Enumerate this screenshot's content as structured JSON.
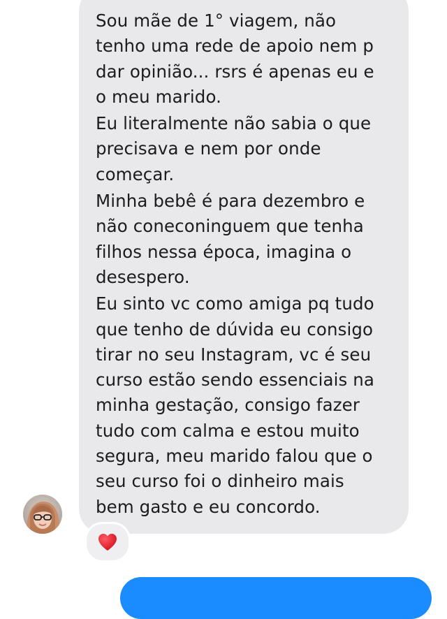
{
  "conversation": {
    "incoming_message": {
      "paragraphs": [
        "Sou mãe de 1° viagem, não\ntenho uma rede de apoio nem p\ndar opinião... rsrs é apenas eu e\no meu marido.",
        "Eu literalmente não sabia o que\nprecisava e nem por onde\ncomeçar.",
        "Minha bebê é para dezembro e\nnão coneconinguem que tenha\nfilhos nessa época, imagina o\ndesespero.",
        "Eu sinto vc como amiga pq tudo\nque tenho de dúvida eu consigo\ntirar no seu Instagram,  vc é seu\ncurso estão sendo essenciais na\nminha gestação, consigo fazer\ntudo com calma e estou muito\nsegura, meu marido falou que o\nseu curso foi o dinheiro mais\nbem gasto e eu concordo."
      ],
      "reaction_icon": "red-heart-icon"
    },
    "sender_avatar_icon": "profile-photo-avatar"
  },
  "colors": {
    "incoming_bubble": "#e9e9eb",
    "text": "#1c1c1e",
    "heart": "#e8202e",
    "outgoing_bubble": "#1a8cff"
  }
}
